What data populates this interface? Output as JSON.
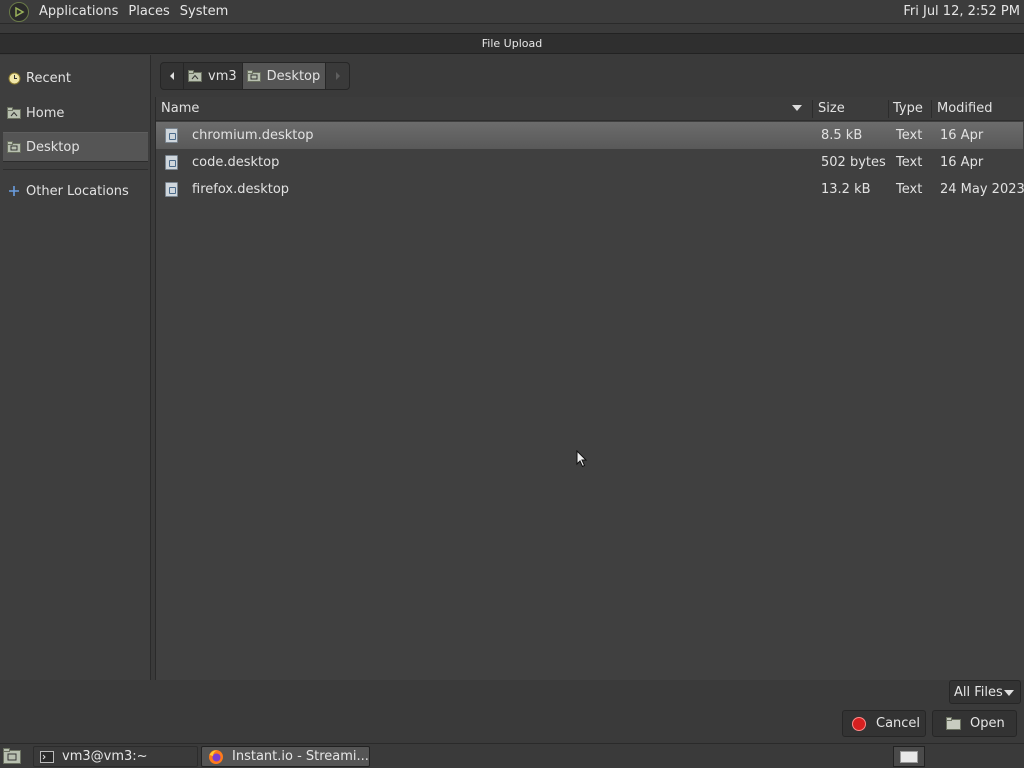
{
  "top_panel": {
    "menus": [
      "Applications",
      "Places",
      "System"
    ],
    "clock": "Fri Jul 12,  2:52 PM"
  },
  "dialog": {
    "title": "File Upload"
  },
  "sidebar": {
    "items": [
      {
        "label": "Recent",
        "icon": "clock-icon"
      },
      {
        "label": "Home",
        "icon": "home-folder-icon"
      },
      {
        "label": "Desktop",
        "icon": "desktop-folder-icon",
        "selected": true
      },
      {
        "label": "Other Locations",
        "icon": "plus-icon"
      }
    ]
  },
  "pathbar": {
    "segments": [
      {
        "label": "vm3",
        "icon": "home-folder-icon"
      },
      {
        "label": "Desktop",
        "icon": "desktop-folder-icon",
        "active": true
      }
    ]
  },
  "filelist": {
    "columns": {
      "name": "Name",
      "size": "Size",
      "type": "Type",
      "modified": "Modified"
    },
    "rows": [
      {
        "name": "chromium.desktop",
        "size": "8.5 kB",
        "type": "Text",
        "modified": "16 Apr",
        "selected": true
      },
      {
        "name": "code.desktop",
        "size": "502 bytes",
        "type": "Text",
        "modified": "16 Apr"
      },
      {
        "name": "firefox.desktop",
        "size": "13.2 kB",
        "type": "Text",
        "modified": "24 May 2023"
      }
    ]
  },
  "controls": {
    "filter": "All Files",
    "cancel": "Cancel",
    "open": "Open"
  },
  "taskbar": {
    "items": [
      {
        "label": "vm3@vm3:~",
        "icon": "terminal-icon"
      },
      {
        "label": "Instant.io - Streami...",
        "icon": "firefox-icon",
        "active": true
      }
    ]
  },
  "colors": {
    "selection": "#5f5f5f",
    "cancel_red": "#d62020",
    "background": "#404040"
  }
}
